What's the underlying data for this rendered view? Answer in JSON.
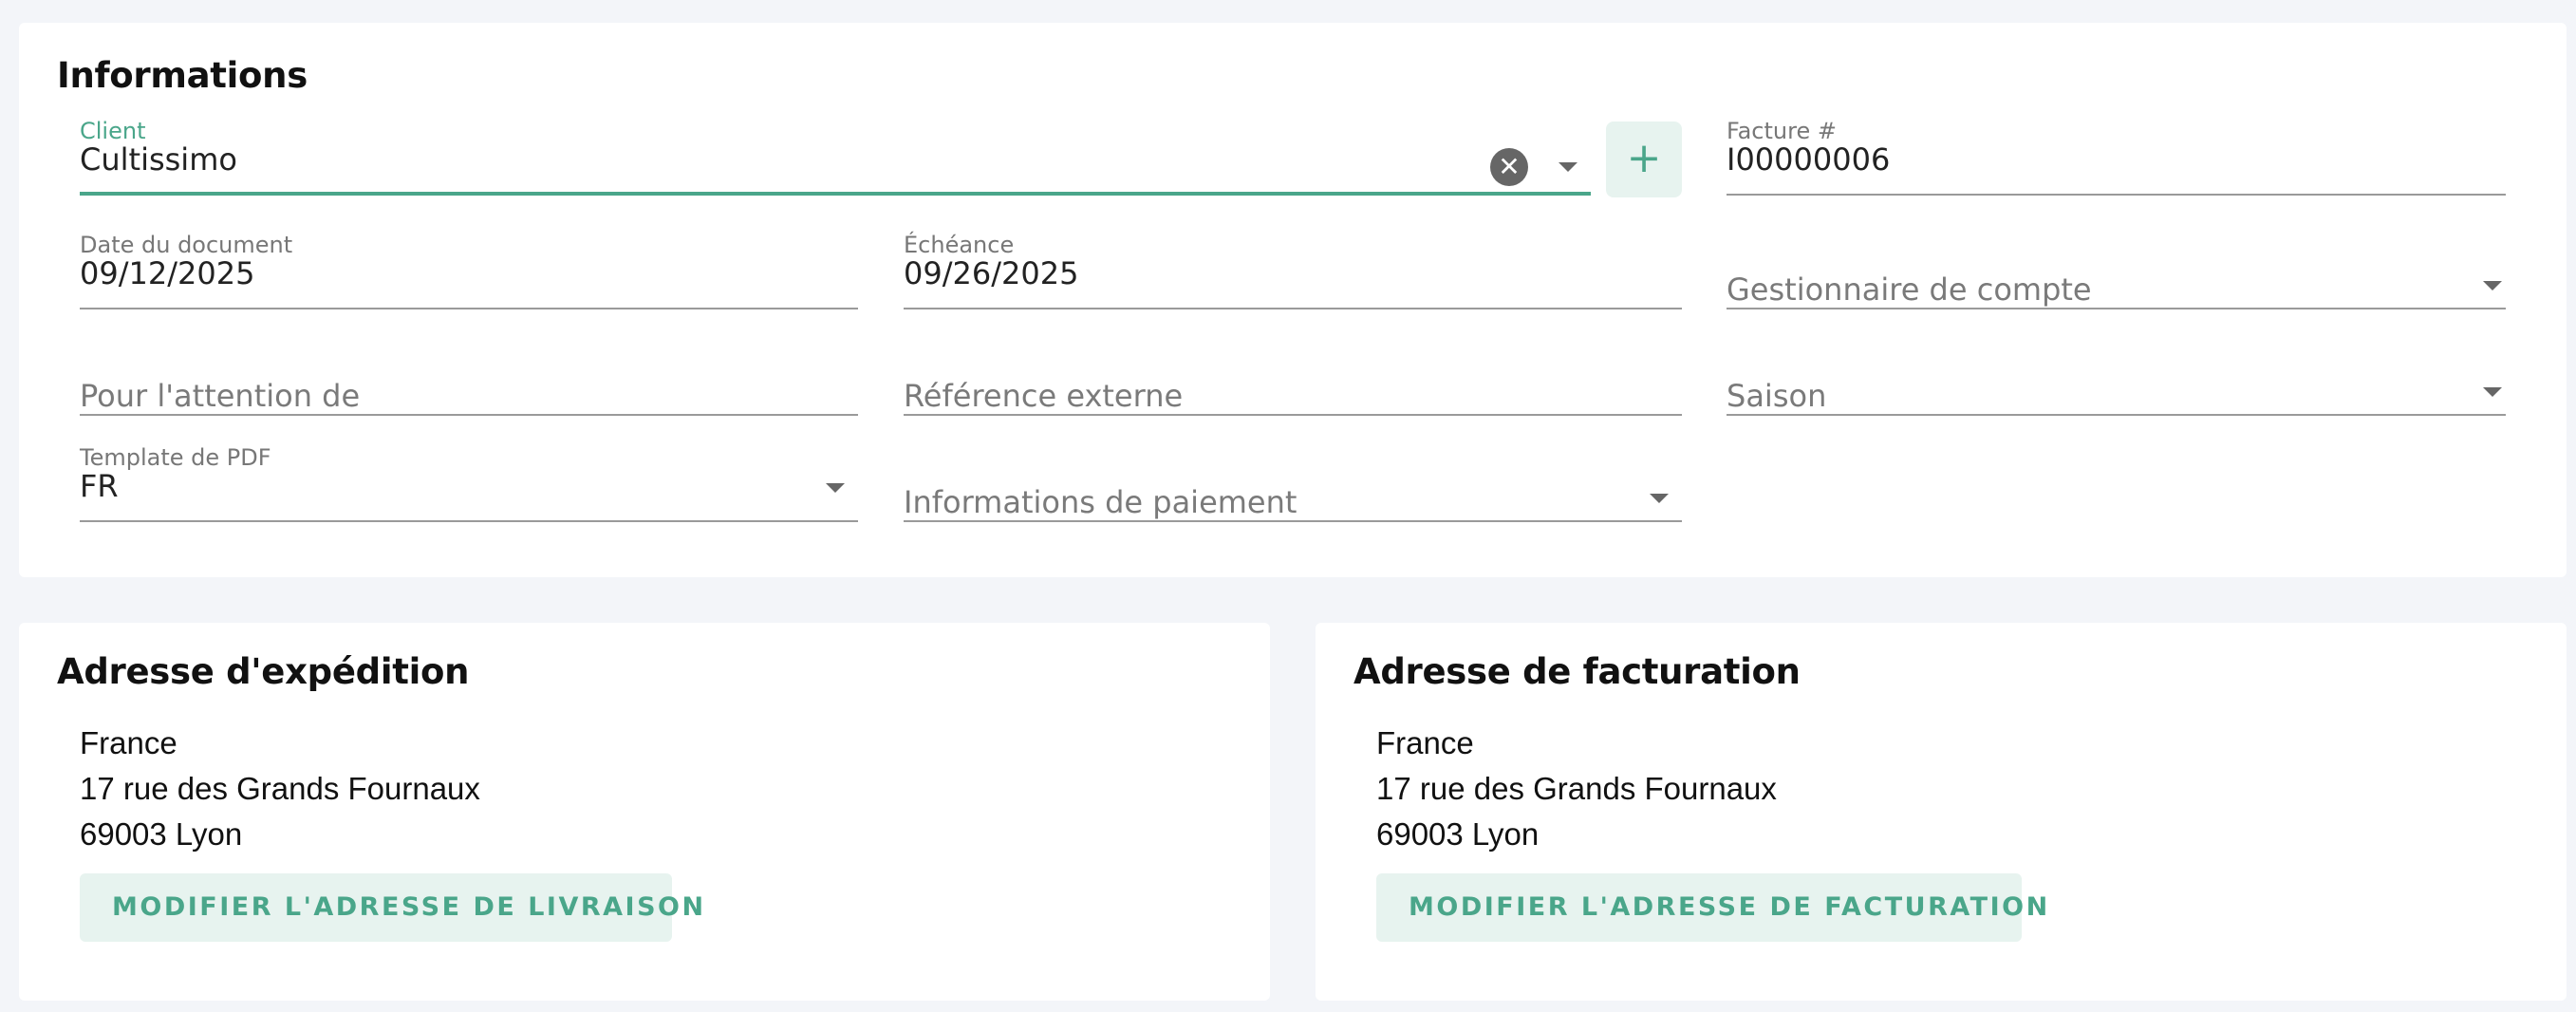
{
  "info": {
    "title": "Informations",
    "client": {
      "label": "Client",
      "value": "Cultissimo",
      "clear_icon": "✕",
      "add_icon": "+"
    },
    "invoice": {
      "label": "Facture #",
      "value": "I00000006"
    },
    "doc_date": {
      "label": "Date du document",
      "value": "09/12/2025"
    },
    "due_date": {
      "label": "Échéance",
      "value": "09/26/2025"
    },
    "account_manager": {
      "placeholder": "Gestionnaire de compte"
    },
    "attention": {
      "placeholder": "Pour l'attention de"
    },
    "external_ref": {
      "placeholder": "Référence externe"
    },
    "season": {
      "placeholder": "Saison"
    },
    "pdf_template": {
      "label": "Template de PDF",
      "value": "FR"
    },
    "payment_info": {
      "placeholder": "Informations de paiement"
    }
  },
  "shipping": {
    "title": "Adresse d'expédition",
    "lines": [
      "France",
      "17 rue des Grands Fournaux",
      "69003 Lyon"
    ],
    "button": "MODIFIER L'ADRESSE DE LIVRAISON"
  },
  "billing": {
    "title": "Adresse de facturation",
    "lines": [
      "France",
      "17 rue des Grands Fournaux",
      "69003 Lyon"
    ],
    "button": "MODIFIER L'ADRESSE DE FACTURATION"
  },
  "colors": {
    "accent": "#4aa68a",
    "accent_bg": "#e7f3ef",
    "page_bg": "#f3f5f9"
  }
}
